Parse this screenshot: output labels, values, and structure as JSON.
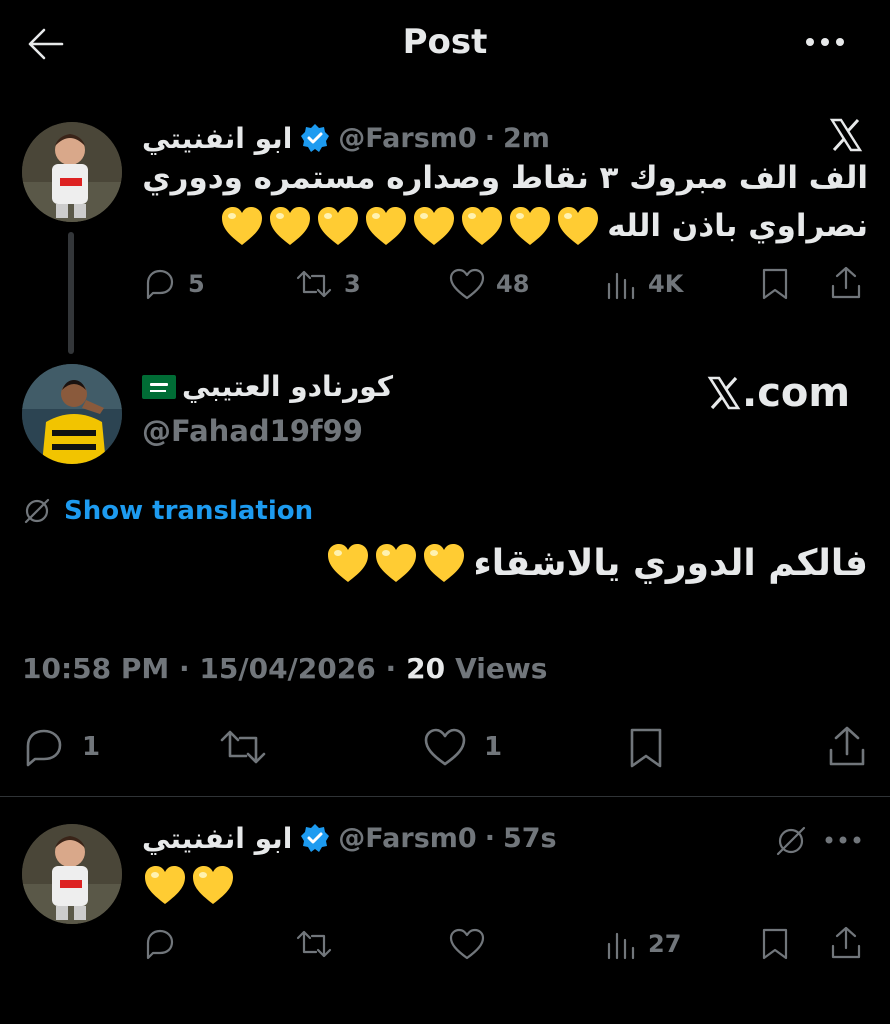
{
  "header": {
    "title": "Post",
    "back_icon": "back-arrow-icon",
    "more_icon": "more-icon"
  },
  "parent_post": {
    "display_name": "ابو انفنيتي",
    "handle": "@Farsm0",
    "time": "2m",
    "text_line1": "الف الف مبروك ٣ نقاط وصداره مستمره ودوري",
    "text_line2": "نصراوي باذن الله",
    "hearts_count": 8,
    "replies": "5",
    "reposts": "3",
    "likes": "48",
    "views": "4K"
  },
  "watermark": "X.com",
  "main_post": {
    "display_name": "كورنادو العتيبي",
    "handle": "@Fahad19f99",
    "show_translation": "Show translation",
    "text": "فالكم الدوري يالاشقاء",
    "hearts_count": 3,
    "timestamp": "10:58 PM · 15/04/2026 ·",
    "views_count": "20",
    "views_label": "Views",
    "replies": "1",
    "likes": "1"
  },
  "reply_post": {
    "display_name": "ابو انفنيتي",
    "handle": "@Farsm0",
    "time": "57s",
    "hearts_count": 2,
    "views": "27"
  },
  "colors": {
    "background": "#000000",
    "text": "#e7e9ea",
    "muted": "#71767b",
    "link": "#1d9bf0",
    "heart": "#ffcc33"
  }
}
